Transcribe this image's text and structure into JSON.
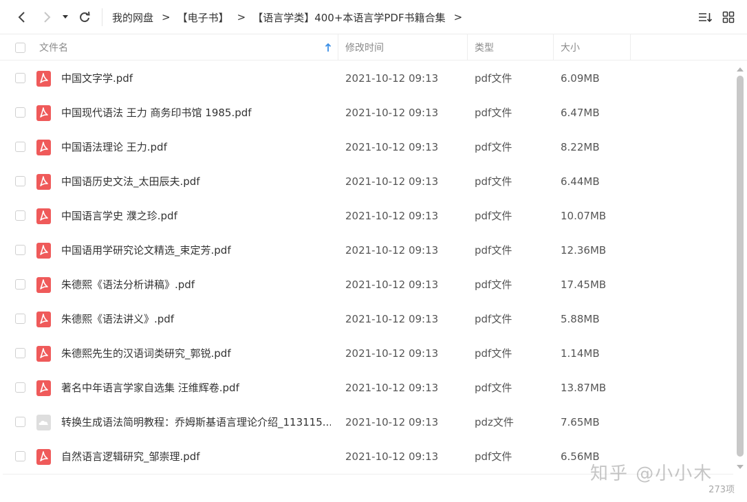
{
  "toolbar": {
    "breadcrumbs": [
      "我的网盘",
      "【电子书】",
      "【语言学类】400+本语言学PDF书籍合集"
    ],
    "separator": ">"
  },
  "columns": {
    "name": "文件名",
    "modified": "修改时间",
    "type": "类型",
    "size": "大小"
  },
  "files": [
    {
      "name": "中国文字学.pdf",
      "modified": "2021-10-12 09:13",
      "type": "pdf文件",
      "size": "6.09MB",
      "icon": "pdf-icon"
    },
    {
      "name": "中国现代语法 王力 商务印书馆 1985.pdf",
      "modified": "2021-10-12 09:13",
      "type": "pdf文件",
      "size": "6.47MB",
      "icon": "pdf-icon"
    },
    {
      "name": "中国语法理论 王力.pdf",
      "modified": "2021-10-12 09:13",
      "type": "pdf文件",
      "size": "8.22MB",
      "icon": "pdf-icon"
    },
    {
      "name": "中国语历史文法_太田辰夫.pdf",
      "modified": "2021-10-12 09:13",
      "type": "pdf文件",
      "size": "6.44MB",
      "icon": "pdf-icon"
    },
    {
      "name": "中国语言学史 濮之珍.pdf",
      "modified": "2021-10-12 09:13",
      "type": "pdf文件",
      "size": "10.07MB",
      "icon": "pdf-icon"
    },
    {
      "name": "中国语用学研究论文精选_束定芳.pdf",
      "modified": "2021-10-12 09:13",
      "type": "pdf文件",
      "size": "12.36MB",
      "icon": "pdf-icon"
    },
    {
      "name": "朱德熙《语法分析讲稿》.pdf",
      "modified": "2021-10-12 09:13",
      "type": "pdf文件",
      "size": "17.45MB",
      "icon": "pdf-icon"
    },
    {
      "name": "朱德熙《语法讲义》.pdf",
      "modified": "2021-10-12 09:13",
      "type": "pdf文件",
      "size": "5.88MB",
      "icon": "pdf-icon"
    },
    {
      "name": "朱德熙先生的汉语词类研究_郭锐.pdf",
      "modified": "2021-10-12 09:13",
      "type": "pdf文件",
      "size": "1.14MB",
      "icon": "pdf-icon"
    },
    {
      "name": "著名中年语言学家自选集 汪维辉卷.pdf",
      "modified": "2021-10-12 09:13",
      "type": "pdf文件",
      "size": "13.87MB",
      "icon": "pdf-icon"
    },
    {
      "name": "转换生成语法简明教程：乔姆斯基语言理论介绍_113115...",
      "modified": "2021-10-12 09:13",
      "type": "pdz文件",
      "size": "7.65MB",
      "icon": "cloud-file-icon"
    },
    {
      "name": "自然语言逻辑研究_邹崇理.pdf",
      "modified": "2021-10-12 09:13",
      "type": "pdf文件",
      "size": "6.56MB",
      "icon": "pdf-icon"
    }
  ],
  "footer": {
    "count": "273项",
    "watermark": "知乎 @小小木"
  },
  "colors": {
    "pdf_icon": "#ef5a5a",
    "sort_arrow": "#3a8ee6"
  }
}
